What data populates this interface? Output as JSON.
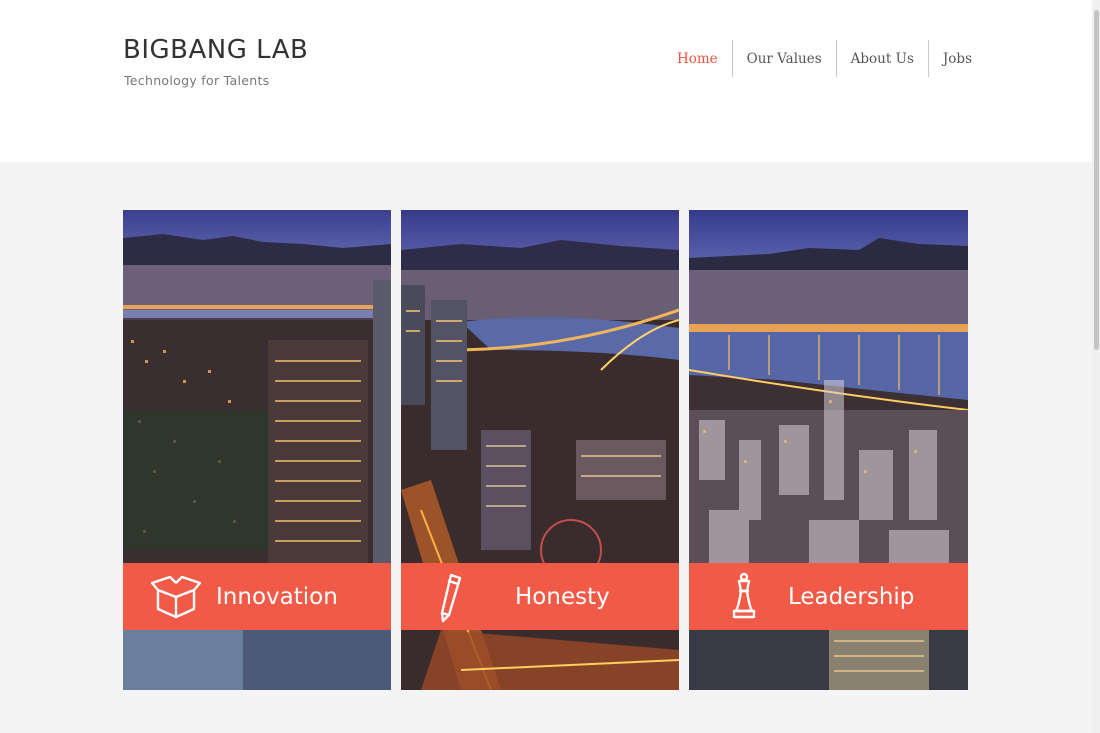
{
  "brand": {
    "title": "BIGBANG LAB",
    "tagline": "Technology for Talents"
  },
  "nav": {
    "items": [
      {
        "label": "Home",
        "active": true
      },
      {
        "label": "Our Values",
        "active": false
      },
      {
        "label": "About Us",
        "active": false
      },
      {
        "label": "Jobs",
        "active": false
      }
    ]
  },
  "values": [
    {
      "label": "Innovation",
      "icon": "open-box-icon"
    },
    {
      "label": "Honesty",
      "icon": "pencil-icon"
    },
    {
      "label": "Leadership",
      "icon": "chess-king-icon"
    }
  ],
  "colors": {
    "accent": "#f15a47",
    "nav_active": "#e8553e",
    "header_bg": "#ffffff",
    "page_bg": "#f4f4f4"
  }
}
